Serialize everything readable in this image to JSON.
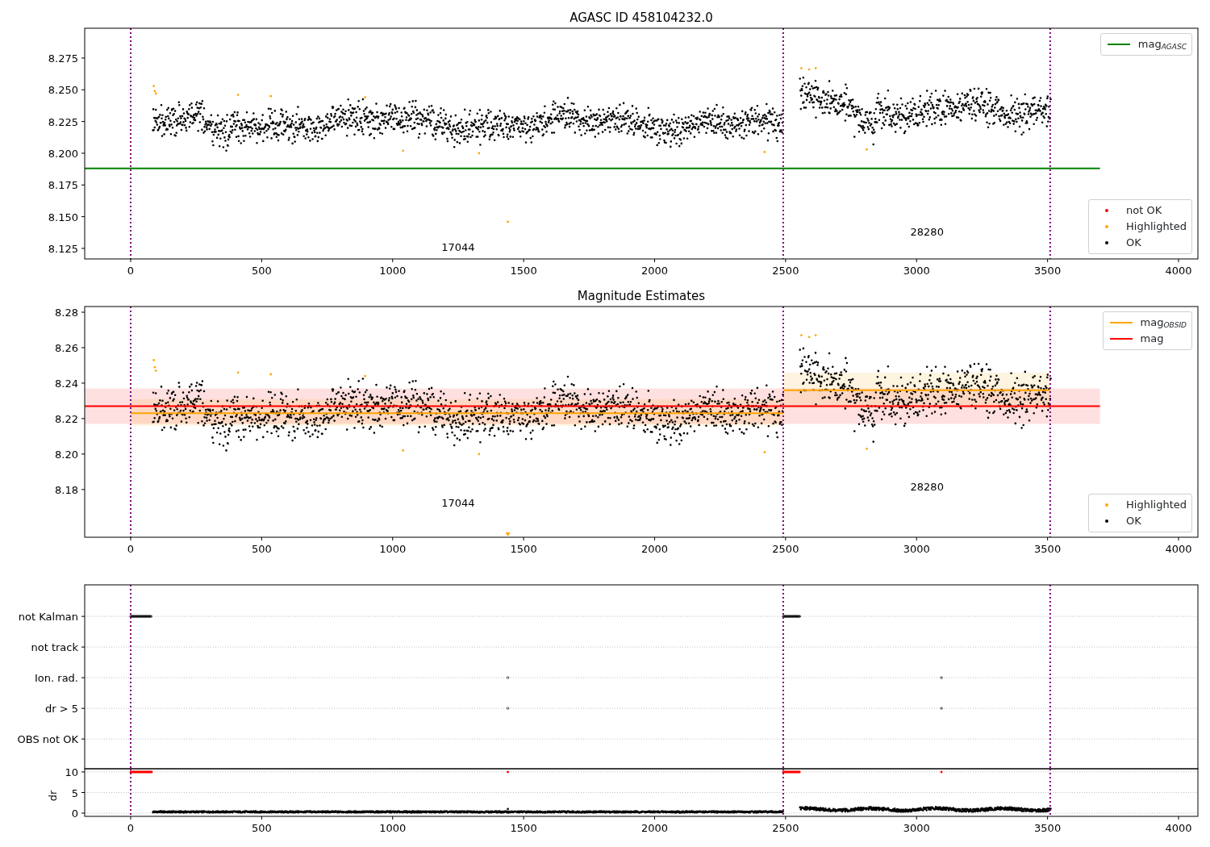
{
  "figure": {
    "panels": [
      {
        "kind": "agasc",
        "title": "AGASC ID 458104232.0",
        "x_tick_labels": [
          "0",
          "500",
          "1000",
          "1500",
          "2000",
          "2500",
          "3000",
          "3500",
          "4000"
        ],
        "y_tick_labels": [
          "8.275",
          "8.250",
          "8.225",
          "8.200",
          "8.175",
          "8.150",
          "8.125"
        ],
        "obsid_labels": [
          "17044",
          "28280"
        ],
        "legends": [
          [
            {
              "kind": "line",
              "label": "mag$_{AGASC}$",
              "color": "#008000"
            }
          ],
          [
            {
              "kind": "dot",
              "label": "not OK",
              "color": "#ff0000"
            },
            {
              "kind": "dot",
              "label": "Highlighted",
              "color": "#ffa500"
            },
            {
              "kind": "dot",
              "label": "OK",
              "color": "#000000"
            }
          ]
        ]
      },
      {
        "kind": "estimates",
        "title": "Magnitude Estimates",
        "x_tick_labels": [
          "0",
          "500",
          "1000",
          "1500",
          "2000",
          "2500",
          "3000",
          "3500",
          "4000"
        ],
        "y_tick_labels": [
          "8.28",
          "8.26",
          "8.24",
          "8.22",
          "8.20",
          "8.18"
        ],
        "obsid_labels": [
          "17044",
          "28280"
        ],
        "legends": [
          [
            {
              "kind": "line",
              "label": "mag$_{OBSID}$",
              "color": "#ffa500"
            },
            {
              "kind": "line",
              "label": "mag",
              "color": "#ff0000"
            }
          ],
          [
            {
              "kind": "dot",
              "label": "Highlighted",
              "color": "#ffa500"
            },
            {
              "kind": "dot",
              "label": "OK",
              "color": "#000000"
            }
          ]
        ]
      },
      {
        "kind": "flags",
        "y_tick_labels": [
          "not Kalman",
          "not track",
          "Ion. rad.",
          "dr > 5",
          "OBS not OK"
        ]
      },
      {
        "kind": "dr",
        "y_label": "dr",
        "x_tick_labels": [
          "0",
          "500",
          "1000",
          "1500",
          "2000",
          "2500",
          "3000",
          "3500",
          "4000"
        ],
        "y_tick_labels": [
          "10",
          "5",
          "0"
        ]
      }
    ]
  }
}
